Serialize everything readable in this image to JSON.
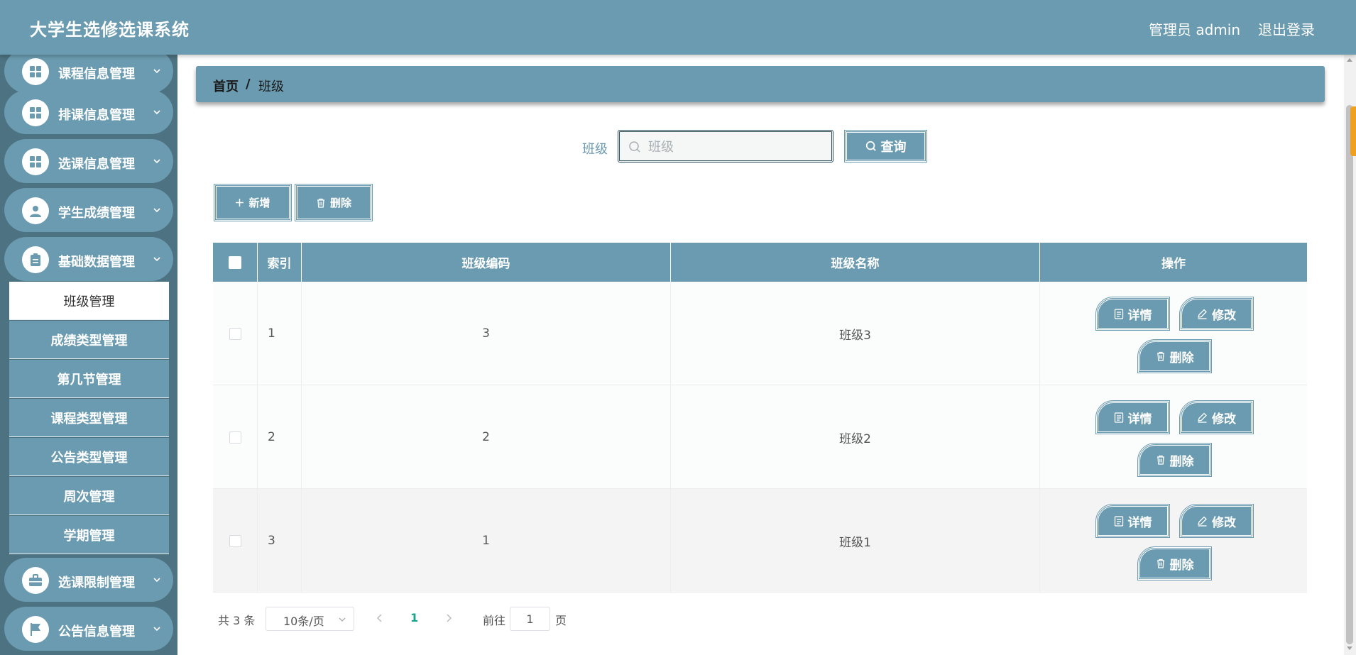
{
  "header": {
    "title": "大学生选修选课系统",
    "user": "管理员 admin",
    "logout": "退出登录"
  },
  "sidebar": {
    "menus": [
      {
        "label": "课程信息管理",
        "icon": "grid-icon"
      },
      {
        "label": "排课信息管理",
        "icon": "grid-icon"
      },
      {
        "label": "选课信息管理",
        "icon": "grid-icon"
      },
      {
        "label": "学生成绩管理",
        "icon": "user-icon"
      },
      {
        "label": "基础数据管理",
        "icon": "clipboard-icon"
      }
    ],
    "submenu": [
      {
        "label": "班级管理",
        "active": true
      },
      {
        "label": "成绩类型管理"
      },
      {
        "label": "第几节管理"
      },
      {
        "label": "课程类型管理"
      },
      {
        "label": "公告类型管理"
      },
      {
        "label": "周次管理"
      },
      {
        "label": "学期管理"
      }
    ],
    "menus_bottom": [
      {
        "label": "选课限制管理",
        "icon": "briefcase-icon"
      },
      {
        "label": "公告信息管理",
        "icon": "flag-icon"
      }
    ]
  },
  "breadcrumb": {
    "home": "首页",
    "separator": "/",
    "current": "班级"
  },
  "search": {
    "label": "班级",
    "placeholder": "班级",
    "query_label": "查询"
  },
  "toolbar": {
    "add_label": "新增",
    "delete_label": "删除"
  },
  "table": {
    "columns": [
      "索引",
      "班级编码",
      "班级名称",
      "操作"
    ],
    "rows": [
      {
        "index": "1",
        "code": "3",
        "name": "班级3"
      },
      {
        "index": "2",
        "code": "2",
        "name": "班级2"
      },
      {
        "index": "3",
        "code": "1",
        "name": "班级1"
      }
    ],
    "actions": {
      "detail": "详情",
      "edit": "修改",
      "delete": "删除"
    }
  },
  "pagination": {
    "total": "共 3 条",
    "page_size": "10条/页",
    "current_page": "1",
    "goto_label": "前往",
    "goto_value": "1",
    "page_suffix": "页"
  },
  "colors": {
    "primary": "#6b9bb0",
    "sidebar_bg": "#4d7281",
    "page_active": "#1aa38a"
  }
}
